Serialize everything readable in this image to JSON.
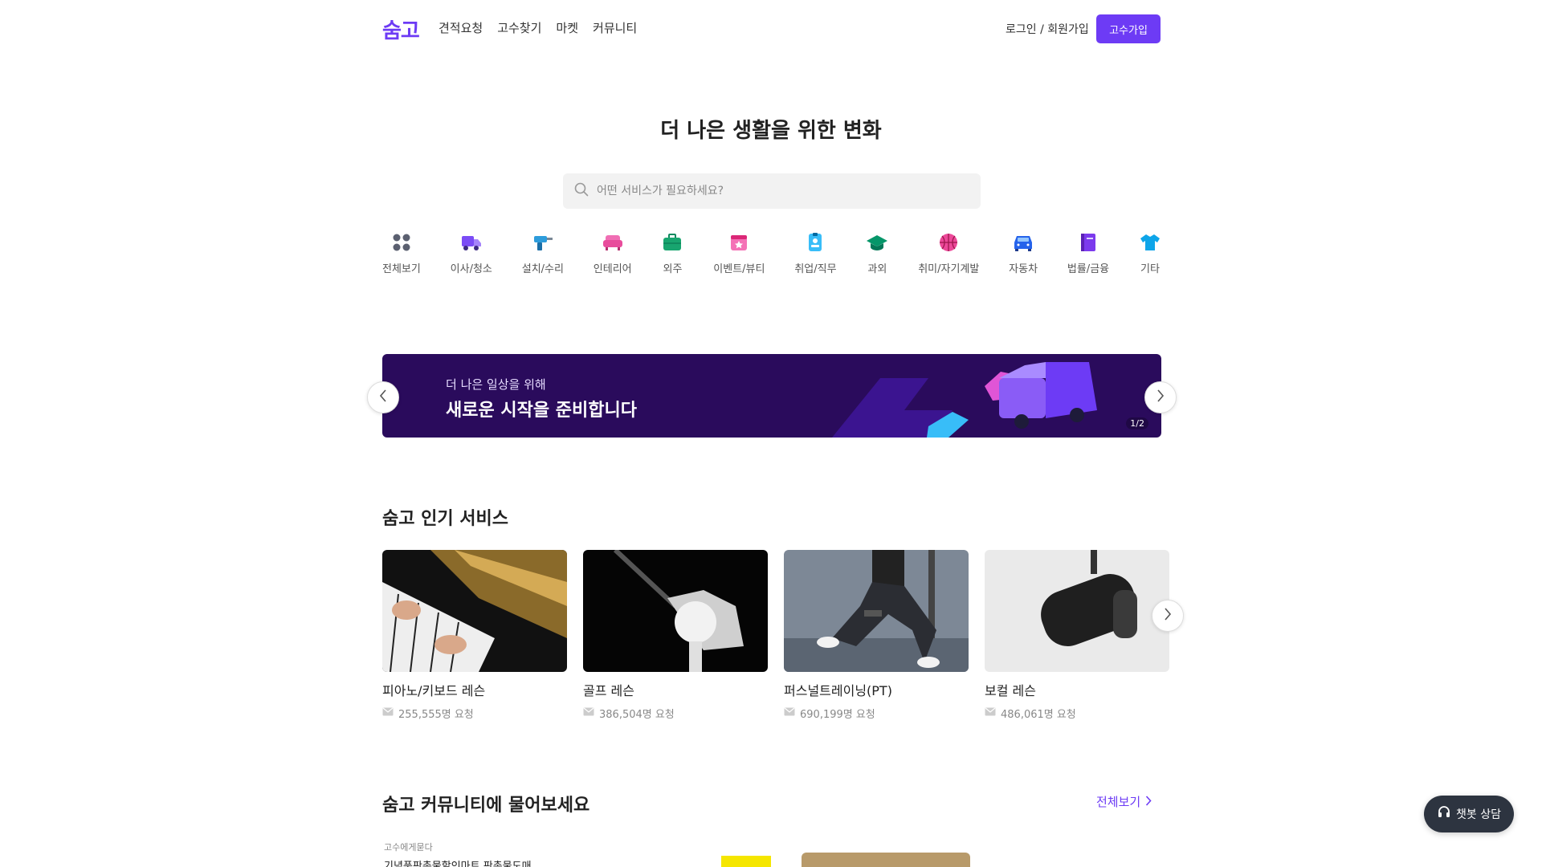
{
  "header": {
    "logo": "숨고",
    "nav": [
      "견적요청",
      "고수찾기",
      "마켓",
      "커뮤니티"
    ],
    "login": "로그인 / 회원가입",
    "signup": "고수가입"
  },
  "hero": {
    "title": "더 나은 생활을 위한 변화",
    "search_placeholder": "어떤 서비스가 필요하세요?"
  },
  "categories": [
    {
      "label": "전체보기",
      "icon": "grid-dots-icon"
    },
    {
      "label": "이사/청소",
      "icon": "truck-icon"
    },
    {
      "label": "설치/수리",
      "icon": "drill-icon"
    },
    {
      "label": "인테리어",
      "icon": "sofa-icon"
    },
    {
      "label": "외주",
      "icon": "briefcase-icon"
    },
    {
      "label": "이벤트/뷰티",
      "icon": "calendar-star-icon"
    },
    {
      "label": "취업/직무",
      "icon": "id-badge-icon"
    },
    {
      "label": "과외",
      "icon": "graduation-cap-icon"
    },
    {
      "label": "취미/자기계발",
      "icon": "basketball-icon"
    },
    {
      "label": "자동차",
      "icon": "car-icon"
    },
    {
      "label": "법률/금융",
      "icon": "book-icon"
    },
    {
      "label": "기타",
      "icon": "tshirt-icon"
    }
  ],
  "banner": {
    "subtitle": "더 나은 일상을 위해",
    "title": "새로운 시작을 준비합니다",
    "page": "1/2"
  },
  "popular": {
    "title": "숨고 인기 서비스",
    "items": [
      {
        "title": "피아노/키보드 레슨",
        "requests": "255,555명 요청"
      },
      {
        "title": "골프 레슨",
        "requests": "386,504명 요청"
      },
      {
        "title": "퍼스널트레이닝(PT)",
        "requests": "690,199명 요청"
      },
      {
        "title": "보컬 레슨",
        "requests": "486,061명 요청"
      }
    ]
  },
  "community": {
    "title": "숨고 커뮤니티에 물어보세요",
    "see_all": "전체보기",
    "post_tag": "고수에게묻다",
    "post_title": "기념품판촉물할인마트 판촉물도매"
  },
  "chat": {
    "label": "챗봇 상담"
  },
  "colors": {
    "brand": "#6d3bf5",
    "banner_bg": "#2a0b5c"
  }
}
